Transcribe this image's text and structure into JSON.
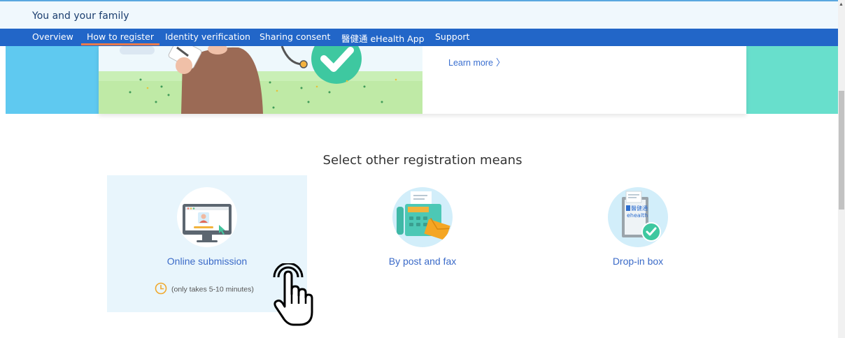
{
  "header": {
    "title": "You and your family"
  },
  "nav": {
    "items": [
      {
        "label": "Overview"
      },
      {
        "label": "How to register"
      },
      {
        "label": "Identity verification"
      },
      {
        "label": "Sharing consent"
      },
      {
        "label": "醫健通 eHealth App"
      },
      {
        "label": "Support"
      }
    ],
    "active_index": 1
  },
  "banner": {
    "learn_more": "Learn more"
  },
  "section": {
    "title": "Select other registration means",
    "options": [
      {
        "label": "Online submission",
        "note": "(only takes 5-10 minutes)",
        "icon": "computer-icon"
      },
      {
        "label": "By post and fax",
        "icon": "fax-icon"
      },
      {
        "label": "Drop-in box",
        "icon": "drop-in-box-icon"
      }
    ]
  },
  "icon_text": {
    "box_chinese": "醫健通",
    "box_ehealth": "ehealth"
  },
  "colors": {
    "nav_bg": "#2266c8",
    "active_underline": "#e97a4b",
    "link": "#3a6ac8",
    "highlight_bg": "#e8f5fc",
    "banner_left": "#5fc9f0",
    "banner_right": "#68dfcc"
  }
}
